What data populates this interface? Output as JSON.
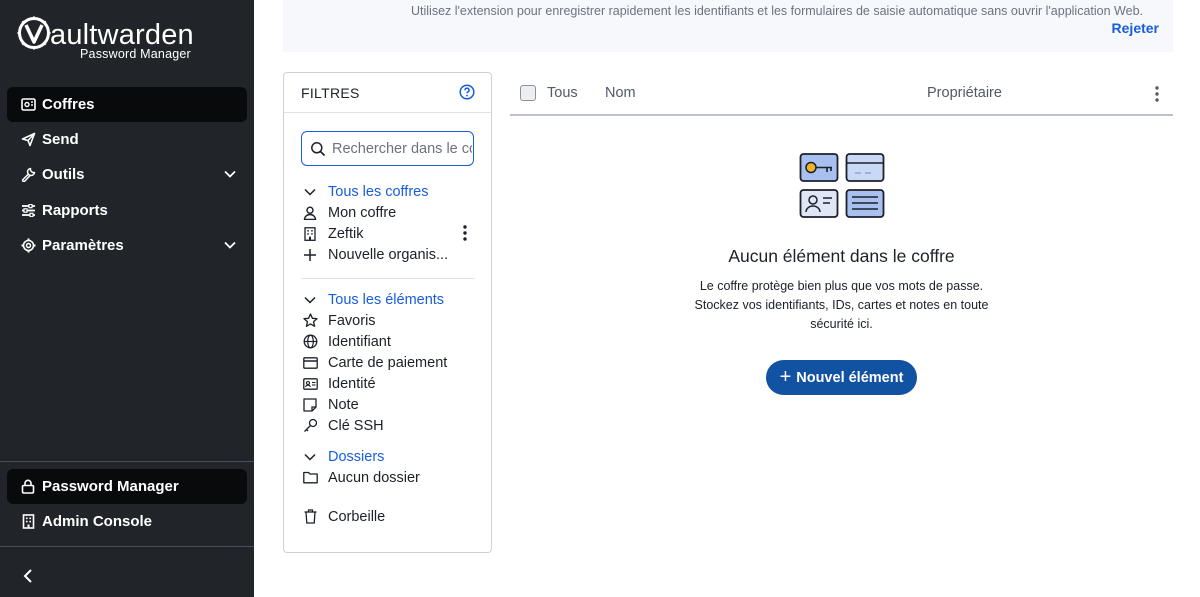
{
  "sidebar": {
    "logo_title": "aultwarden",
    "logo_subtitle": "Password Manager",
    "nav": [
      {
        "label": "Coffres",
        "icon": "vault-icon",
        "active": true
      },
      {
        "label": "Send",
        "icon": "send-icon"
      },
      {
        "label": "Outils",
        "icon": "wrench-icon",
        "expandable": true
      },
      {
        "label": "Rapports",
        "icon": "sliders-icon"
      },
      {
        "label": "Paramètres",
        "icon": "gear-icon",
        "expandable": true
      }
    ],
    "products": [
      {
        "label": "Password Manager",
        "icon": "lock-icon",
        "active": true
      },
      {
        "label": "Admin Console",
        "icon": "building-icon"
      }
    ]
  },
  "banner": {
    "text": "Utilisez l'extension pour enregistrer rapidement les identifiants et les formulaires de saisie automatique sans ouvrir l'application Web.",
    "dismiss_label": "Rejeter"
  },
  "filters": {
    "title": "FILTRES",
    "search_placeholder": "Rechercher dans le coffre",
    "vaults_header": "Tous les coffres",
    "vaults": [
      {
        "label": "Mon coffre",
        "icon": "user-icon"
      },
      {
        "label": "Zeftik",
        "icon": "building-icon"
      },
      {
        "label": "Nouvelle organis...",
        "icon": "plus-icon"
      }
    ],
    "types_header": "Tous les éléments",
    "types": [
      {
        "label": "Favoris",
        "icon": "star-icon"
      },
      {
        "label": "Identifiant",
        "icon": "globe-icon"
      },
      {
        "label": "Carte de paiement",
        "icon": "credit-card-icon"
      },
      {
        "label": "Identité",
        "icon": "id-card-icon"
      },
      {
        "label": "Note",
        "icon": "sticky-note-icon"
      },
      {
        "label": "Clé SSH",
        "icon": "key-icon"
      }
    ],
    "folders_header": "Dossiers",
    "folders": [
      {
        "label": "Aucun dossier",
        "icon": "folder-icon"
      }
    ],
    "trash_label": "Corbeille"
  },
  "table": {
    "select_all_label": "Tous",
    "col_name": "Nom",
    "col_owner": "Propriétaire"
  },
  "empty_state": {
    "title": "Aucun élément dans le coffre",
    "description": "Le coffre protège bien plus que vos mots de passe. Stockez vos identifiants, IDs, cartes et notes en toute sécurité ici.",
    "button_label": "Nouvel élément"
  },
  "colors": {
    "sidebar_bg": "#212529",
    "accent": "#175ddc",
    "primary_button": "#1252a3"
  }
}
